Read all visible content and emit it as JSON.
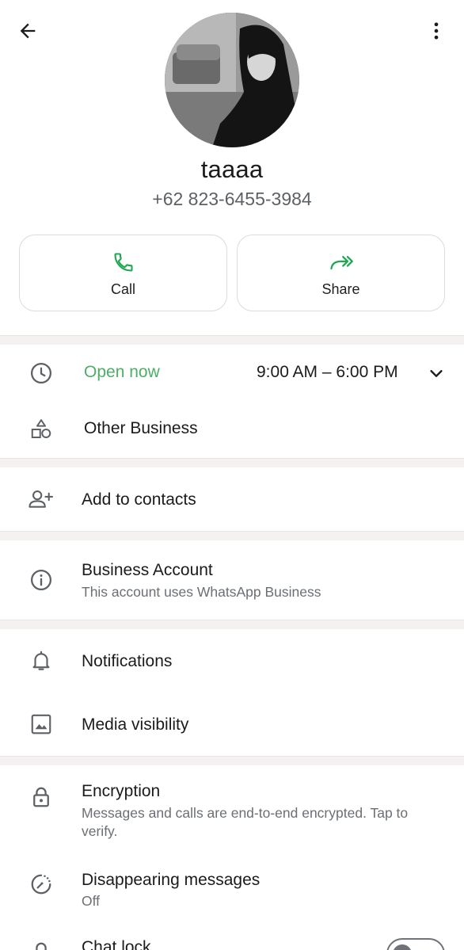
{
  "header": {
    "back_icon": "arrow-left-icon",
    "menu_icon": "more-vert-icon",
    "profile_name": "taaaa",
    "phone_number": "+62 823-6455-3984"
  },
  "actions": {
    "call_label": "Call",
    "share_label": "Share",
    "accent_color": "#1da851"
  },
  "business_info": {
    "status": "Open now",
    "status_color": "#4caf66",
    "hours": "9:00 AM – 6:00 PM",
    "category": "Other Business"
  },
  "contacts": {
    "add_label": "Add to contacts"
  },
  "business_account": {
    "title": "Business Account",
    "subtitle": "This account uses WhatsApp Business"
  },
  "settings": {
    "notifications": "Notifications",
    "media_visibility": "Media visibility"
  },
  "privacy": {
    "encryption_title": "Encryption",
    "encryption_sub": "Messages and calls are end-to-end encrypted. Tap to verify.",
    "disappearing_title": "Disappearing messages",
    "disappearing_sub": "Off",
    "chat_lock_title": "Chat lock"
  }
}
